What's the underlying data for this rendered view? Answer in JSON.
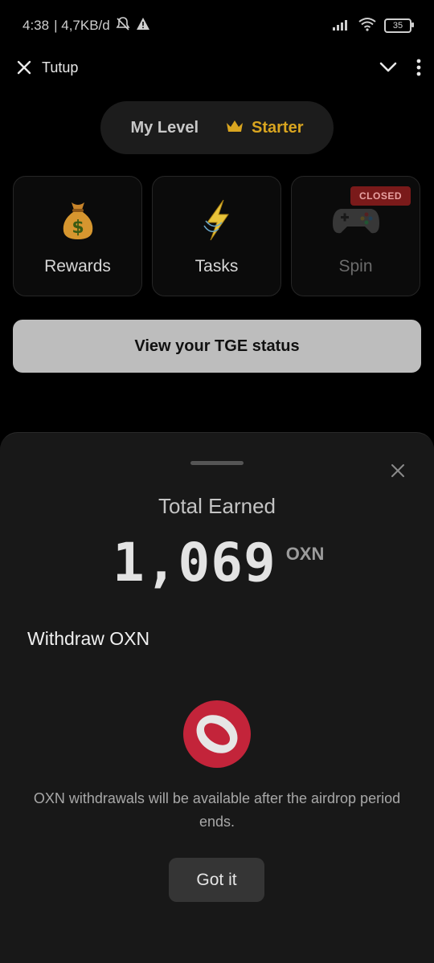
{
  "status_bar": {
    "time": "4:38",
    "network_speed": "| 4,7KB/d",
    "battery": "35"
  },
  "top_bar": {
    "close_label": "Tutup"
  },
  "level": {
    "label": "My Level",
    "value": "Starter",
    "accent_color": "#d9a520"
  },
  "tiles": [
    {
      "label": "Rewards",
      "icon": "money-bag-icon",
      "closed": false
    },
    {
      "label": "Tasks",
      "icon": "lightning-icon",
      "closed": false
    },
    {
      "label": "Spin",
      "icon": "gamepad-icon",
      "closed": true,
      "badge": "CLOSED"
    }
  ],
  "tge_button": {
    "label": "View your TGE status"
  },
  "sheet": {
    "title": "Total Earned",
    "amount": "1,069",
    "unit": "OXN",
    "withdraw_title": "Withdraw OXN",
    "notice": "OXN withdrawals will be available after the airdrop period ends.",
    "got_it_label": "Got it",
    "coin_color": "#c3243a"
  }
}
